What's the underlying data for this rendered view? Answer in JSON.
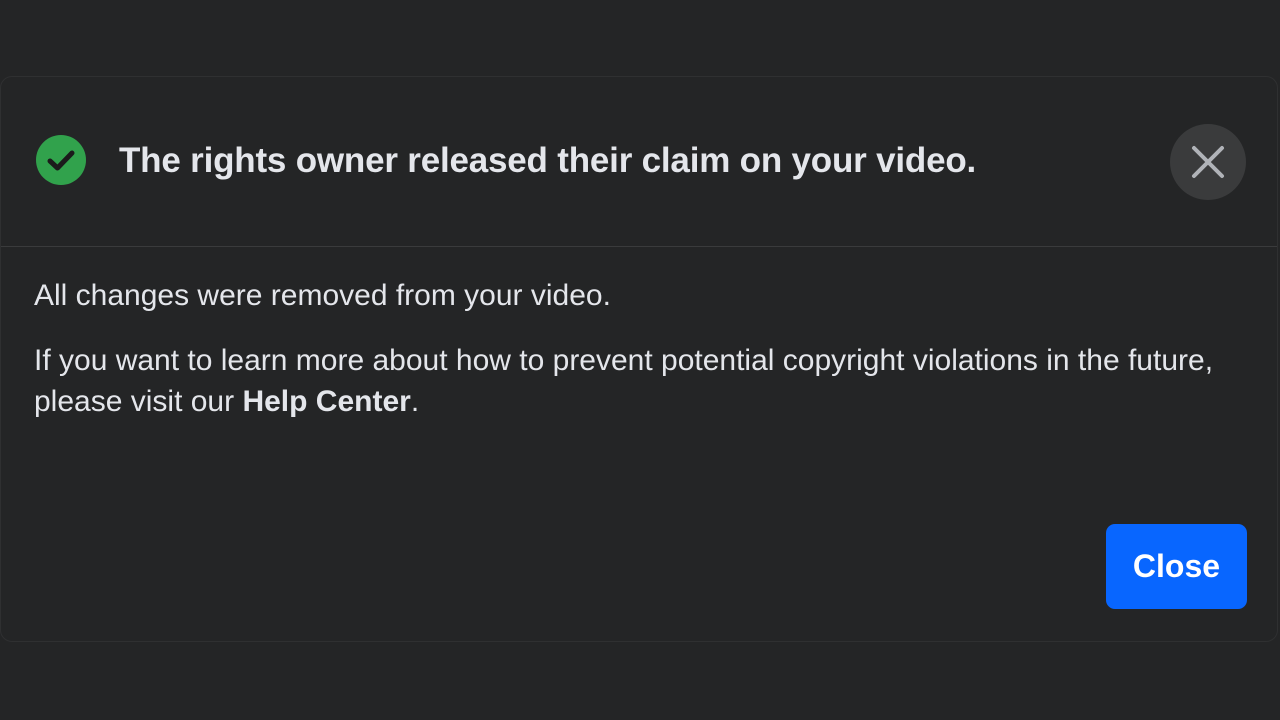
{
  "dialog": {
    "title": "The rights owner released their claim on your video.",
    "icons": {
      "status": "check-circle-icon",
      "dismiss": "close-icon"
    },
    "body": {
      "line1": "All changes were removed from your video.",
      "line2_prefix": "If you want to learn more about how to prevent potential copyright violations in the future, please visit our ",
      "link_text": "Help Center",
      "line2_suffix": "."
    },
    "primary_button": "Close"
  },
  "colors": {
    "background": "#242526",
    "text": "#e4e6eb",
    "success": "#31a24c",
    "primary": "#0866ff",
    "icon_button_bg": "#3a3b3c"
  }
}
